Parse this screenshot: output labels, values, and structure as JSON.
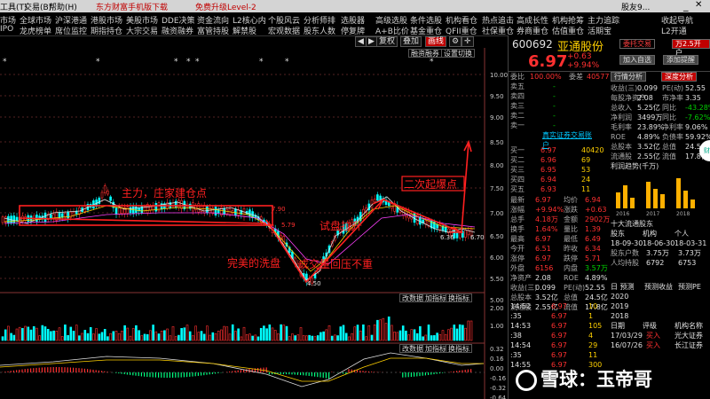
{
  "menu": {
    "items": [
      "工具(T)",
      "交易(B)",
      "帮助(H)",
      "东方财富手机版下载",
      "免费升级Level-2",
      "股友9...",
      "..."
    ]
  },
  "nav_row1": [
    "市场",
    "全球市场",
    "沪深港通",
    "港股市场",
    "美股市场",
    "DDE决策",
    "资金流向",
    "L2核心内",
    "个股风云",
    "分析师排",
    "选股器",
    "高级选股",
    "条件选股",
    "机构看仓",
    "热点追击",
    "高成长性",
    "机构抢筹",
    "主力追踪",
    "收起导航"
  ],
  "nav_row2": [
    "IPO",
    "龙虎榜单",
    "席位监控",
    "期指持仓",
    "大宗交易",
    "融资融券",
    "富管持股",
    "解禁股",
    "宏观数据",
    "股东人数",
    "停复牌",
    "A+B比价",
    "基金重仓",
    "QFII重仓",
    "社保重仓",
    "券商重仓",
    "估值重仓",
    "活期宝",
    "L2开通"
  ],
  "chart_ctl": {
    "back": "◀",
    "fwd": "▶",
    "rights": "复权",
    "overlay": "叠加",
    "draw": "画线",
    "stat1": "融资融券",
    "stat2": "设置切换"
  },
  "chart": {
    "y_labels": [
      "10.00",
      "9.50",
      "9.00",
      "8.50",
      "8.00",
      "7.50",
      "7.00",
      "6.50",
      "6.00",
      "5.50",
      "5.00"
    ],
    "price_tags": {
      "hi": "7.90",
      "lo": "4.50",
      "mid": "5.79",
      "cur": "6.36",
      "right": "6.70"
    },
    "annotations": {
      "main": "主力，庄家建仓点",
      "wash": "完美的洗盘",
      "vol": "成交量回压不重",
      "test": "试盘拉升",
      "second": "二次起爆点"
    },
    "sub_tabs": [
      "改数据",
      "加指标",
      "换指标"
    ],
    "vol_labels": [
      "2.00",
      "1.00"
    ],
    "macd_labels": [
      "0.32",
      "0.16",
      "0.00",
      "-0.16",
      "-0.32",
      "-0.64"
    ]
  },
  "stock": {
    "code": "600692",
    "name": "亚通股份",
    "trade_btn": "委托交易",
    "level2": "万2.5开户",
    "price": "6.97",
    "chg": "+0.63",
    "pct": "+9.94%",
    "add_btn": "加入自选",
    "remind_btn": "添加提醒"
  },
  "ratios": {
    "wb_lbl": "委比",
    "wb": "100.00%",
    "wc_lbl": "委差",
    "wc": "40577"
  },
  "sells": [
    {
      "label": "卖五",
      "price": "-",
      "vol": ""
    },
    {
      "label": "卖四",
      "price": "-",
      "vol": ""
    },
    {
      "label": "卖三",
      "price": "-",
      "vol": ""
    },
    {
      "label": "卖二",
      "price": "-",
      "vol": ""
    },
    {
      "label": "卖一",
      "price": "-",
      "vol": ""
    }
  ],
  "ad": "真实证券交易账户",
  "buys": [
    {
      "label": "买一",
      "price": "6.97",
      "vol": "40420"
    },
    {
      "label": "买二",
      "price": "6.96",
      "vol": "69"
    },
    {
      "label": "买三",
      "price": "6.95",
      "vol": "53"
    },
    {
      "label": "买四",
      "price": "6.94",
      "vol": "24"
    },
    {
      "label": "买五",
      "price": "6.93",
      "vol": "11"
    }
  ],
  "quote": [
    [
      "最新",
      "6.97",
      "均价",
      "6.94"
    ],
    [
      "涨幅",
      "+9.94%",
      "涨跌",
      "+0.63"
    ],
    [
      "总手",
      "4.18万",
      "金额",
      "2902万"
    ],
    [
      "换手",
      "1.64%",
      "量比",
      "1.39"
    ],
    [
      "最高",
      "6.97",
      "最低",
      "6.49"
    ],
    [
      "今开",
      "6.51",
      "昨收",
      "6.34"
    ],
    [
      "涨停",
      "6.97",
      "跌停",
      "5.71"
    ],
    [
      "外盘",
      "6156",
      "内盘",
      "3.57万"
    ],
    [
      "净资产",
      "2.08",
      "ROE",
      "4.89%"
    ],
    [
      "收益(三)",
      "0.099",
      "PE(动)",
      "52.55"
    ],
    [
      "总股本",
      "3.52亿",
      "总值",
      "24.5亿"
    ],
    [
      "流通股",
      "2.55亿",
      "流值",
      "17.8亿"
    ]
  ],
  "ticks": [
    [
      "14:52",
      "6.97",
      "10"
    ],
    [
      ":35",
      "6.97",
      "1"
    ],
    [
      "14:53",
      "6.97",
      "105"
    ],
    [
      ":38",
      "6.97",
      "4"
    ],
    [
      "14:54",
      "6.97",
      "29"
    ],
    [
      ":35",
      "6.97",
      "11"
    ],
    [
      "14:55",
      "6.97",
      "300"
    ]
  ],
  "f10": {
    "tabs": [
      "行情分析",
      "深度分析"
    ],
    "items": [
      [
        "收益(三)",
        "0.099",
        "PE(动)",
        "52.55"
      ],
      [
        "每股净资产",
        "2.08",
        "市净率",
        "3.35"
      ],
      [
        "总收入",
        "5.25亿",
        "同比",
        "-43.28%"
      ],
      [
        "净利润",
        "3499万",
        "同比",
        "-7.62%"
      ],
      [
        "毛利率",
        "23.89%",
        "净利率",
        "9.06%"
      ],
      [
        "ROE",
        "4.89%",
        "负债率",
        "59.92%"
      ],
      [
        "总股本",
        "3.52亿",
        "总值",
        "24.5亿"
      ],
      [
        "流通股",
        "2.55亿",
        "流值",
        "17.8亿"
      ]
    ],
    "profit_title": "利润趋势(千万)",
    "years": [
      "2016",
      "2017",
      "2018"
    ],
    "holders_title": "十大流通股东",
    "holders_hdr": [
      "股东",
      "机构",
      "个人"
    ],
    "holders_vals": [
      "18-09-30",
      "18-06-30",
      "18-03-31"
    ],
    "hold_rows": [
      [
        "股东户数",
        "3.75万",
        "3.73万"
      ],
      [
        "人均持股",
        "6792",
        "6753"
      ]
    ],
    "fc_tabs": [
      "日 预测",
      "预测收益",
      "预测PE"
    ],
    "fc_years": [
      "2020",
      "2019",
      "2018"
    ],
    "ratings_hdr": [
      "日期",
      "评级",
      "机构名称"
    ],
    "ratings": [
      [
        "17/03/29",
        "买入",
        "光大证券"
      ],
      [
        "16/07/26",
        "买入",
        "长江证券"
      ]
    ]
  },
  "watermark": "雪球：玉帝哥",
  "side_logo": "财经"
}
